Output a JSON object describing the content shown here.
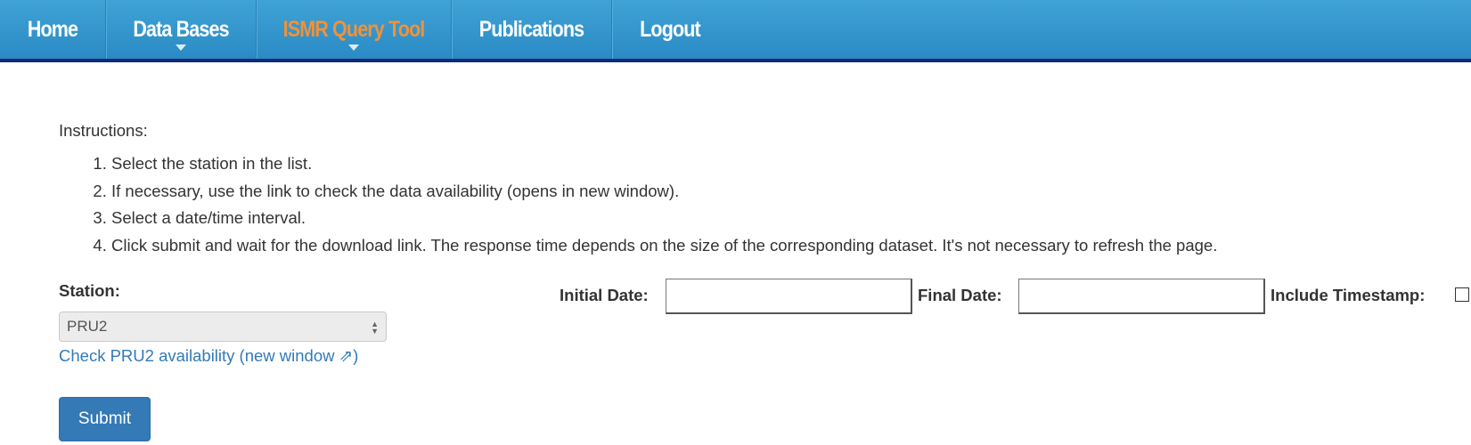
{
  "nav": {
    "items": [
      {
        "label": "Home",
        "has_dropdown": false,
        "active": false
      },
      {
        "label": "Data Bases",
        "has_dropdown": true,
        "active": false
      },
      {
        "label": "ISMR Query Tool",
        "has_dropdown": true,
        "active": true
      },
      {
        "label": "Publications",
        "has_dropdown": false,
        "active": false
      },
      {
        "label": "Logout",
        "has_dropdown": false,
        "active": false
      }
    ]
  },
  "instructions": {
    "label": "Instructions:",
    "steps": [
      "Select the station in the list.",
      "If necessary, use the link to check the data availability (opens in new window).",
      "Select a date/time interval.",
      "Click submit and wait for the download link. The response time depends on the size of the corresponding dataset. It's not necessary to refresh the page."
    ]
  },
  "form": {
    "station_label": "Station:",
    "station_value": "PRU2",
    "availability_link": "Check PRU2 availability (new window ⇗)",
    "initial_date_label": "Initial Date:",
    "initial_date_value": "",
    "final_date_label": "Final Date:",
    "final_date_value": "",
    "include_timestamp_label": "Include Timestamp:",
    "include_timestamp_checked": false,
    "submit_label": "Submit"
  },
  "colors": {
    "nav_background": "#3297ce",
    "nav_active_text": "#f0923a",
    "link": "#337ab7",
    "submit_background": "#337ab7"
  }
}
